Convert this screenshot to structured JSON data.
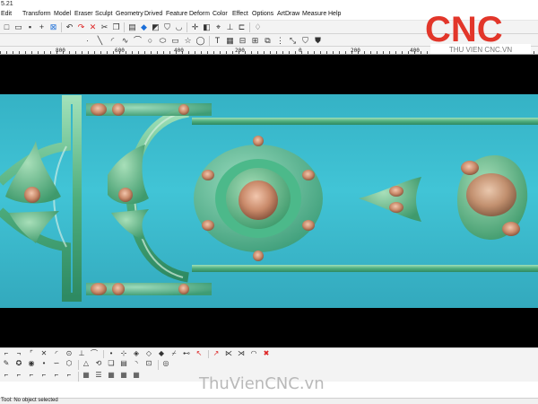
{
  "window": {
    "title": "5.21"
  },
  "menu": [
    "Edit",
    "Transform",
    "Model",
    "Eraser",
    "Sculpt",
    "Geometry",
    "Drived",
    "Feature",
    "Deform",
    "Color",
    "Effect",
    "Options",
    "ArtDraw",
    "Measure",
    "Help"
  ],
  "toolbar_top": [
    {
      "icon": "new-file-icon",
      "glyph": "□"
    },
    {
      "icon": "open-folder-icon",
      "glyph": "▭"
    },
    {
      "icon": "save-icon",
      "glyph": "▪"
    },
    {
      "icon": "crosshair-icon",
      "glyph": "+"
    },
    {
      "icon": "grid-select-icon",
      "glyph": "⊠"
    },
    {
      "icon": "undo-icon",
      "glyph": "↶"
    },
    {
      "icon": "redo-icon",
      "glyph": "↷"
    },
    {
      "icon": "delete-icon",
      "glyph": "✕"
    },
    {
      "icon": "cut-icon",
      "glyph": "✂"
    },
    {
      "icon": "copy-icon",
      "glyph": "❐"
    },
    {
      "icon": "paste-icon",
      "glyph": "▤"
    },
    {
      "icon": "color-fill-icon",
      "glyph": "◆"
    },
    {
      "icon": "cube-icon",
      "glyph": "◩"
    },
    {
      "icon": "shield-icon",
      "glyph": "⛉"
    },
    {
      "icon": "cup-icon",
      "glyph": "◡"
    },
    {
      "icon": "move-icon",
      "glyph": "✛"
    },
    {
      "icon": "mirror-icon",
      "glyph": "◧"
    },
    {
      "icon": "node-icon",
      "glyph": "⌖"
    },
    {
      "icon": "measure-icon",
      "glyph": "⊥"
    },
    {
      "icon": "align-icon",
      "glyph": "⊏"
    },
    {
      "icon": "lamp-icon",
      "glyph": "♢"
    }
  ],
  "toolbar_draw": [
    {
      "icon": "point-icon",
      "glyph": "·"
    },
    {
      "icon": "line-icon",
      "glyph": "╲"
    },
    {
      "icon": "arc-icon",
      "glyph": "◜"
    },
    {
      "icon": "curve-icon",
      "glyph": "∿"
    },
    {
      "icon": "polyline-icon",
      "glyph": "⌒"
    },
    {
      "icon": "circle-icon",
      "glyph": "○"
    },
    {
      "icon": "ellipse-icon",
      "glyph": "⬭"
    },
    {
      "icon": "rectangle-icon",
      "glyph": "▭"
    },
    {
      "icon": "star-icon",
      "glyph": "☆"
    },
    {
      "icon": "ring-icon",
      "glyph": "◯"
    },
    {
      "icon": "text-tool-icon",
      "glyph": "T"
    },
    {
      "icon": "grid-icon",
      "glyph": "▦"
    },
    {
      "icon": "align-left-icon",
      "glyph": "⊟"
    },
    {
      "icon": "distribute-icon",
      "glyph": "⊞"
    },
    {
      "icon": "group-icon",
      "glyph": "⧉"
    },
    {
      "icon": "array-icon",
      "glyph": "⋮"
    },
    {
      "icon": "scale-icon",
      "glyph": "⤡"
    },
    {
      "icon": "badge-icon",
      "glyph": "⛉"
    },
    {
      "icon": "shield-alt-icon",
      "glyph": "⛊"
    }
  ],
  "ruler": {
    "labels": [
      "800",
      "600",
      "400",
      "200",
      "0",
      "200",
      "400",
      "600"
    ]
  },
  "props_row1": [
    {
      "icon": "snap-start-icon",
      "glyph": "⌐"
    },
    {
      "icon": "snap-end-icon",
      "glyph": "¬"
    },
    {
      "icon": "snap-mid-icon",
      "glyph": "⌜"
    },
    {
      "icon": "snap-cross-icon",
      "glyph": "✕"
    },
    {
      "icon": "snap-arc-icon",
      "glyph": "◜"
    },
    {
      "icon": "snap-center-icon",
      "glyph": "⊙"
    },
    {
      "icon": "snap-perp-icon",
      "glyph": "⊥"
    },
    {
      "icon": "snap-tangent-icon",
      "glyph": "⌒"
    },
    {
      "icon": "snap-point-icon",
      "glyph": "•"
    },
    {
      "icon": "snap-near-icon",
      "glyph": "⊹"
    },
    {
      "icon": "node-edit-icon",
      "glyph": "◈"
    },
    {
      "icon": "node-add-icon",
      "glyph": "◇"
    },
    {
      "icon": "node-del-icon",
      "glyph": "◆"
    },
    {
      "icon": "break-icon",
      "glyph": "⌿"
    },
    {
      "icon": "join-icon",
      "glyph": "⊷"
    },
    {
      "icon": "red-arrow-icon",
      "glyph": "↖"
    },
    {
      "icon": "red-arrow-alt-icon",
      "glyph": "↗"
    },
    {
      "icon": "trim-icon",
      "glyph": "⋉"
    },
    {
      "icon": "extend-icon",
      "glyph": "⋊"
    },
    {
      "icon": "fillet-icon",
      "glyph": "◠"
    },
    {
      "icon": "red-close-icon",
      "glyph": "✖"
    }
  ],
  "props_row2": [
    {
      "icon": "pen-icon",
      "glyph": "✎"
    },
    {
      "icon": "lightbulb-icon",
      "glyph": "✪"
    },
    {
      "icon": "node-yellow-icon",
      "glyph": "◉"
    },
    {
      "icon": "dot-tool-icon",
      "glyph": "•"
    },
    {
      "icon": "wave-icon",
      "glyph": "∽"
    },
    {
      "icon": "polygon-icon",
      "glyph": "⬡"
    },
    {
      "icon": "triangle-icon",
      "glyph": "△"
    },
    {
      "icon": "rotate-icon",
      "glyph": "⟲"
    },
    {
      "icon": "pages-icon",
      "glyph": "❏"
    },
    {
      "icon": "document-icon",
      "glyph": "▤"
    },
    {
      "icon": "arc-tool-icon",
      "glyph": "◝"
    },
    {
      "icon": "offset-icon",
      "glyph": "⊡"
    },
    {
      "icon": "spiral-icon",
      "glyph": "◎"
    }
  ],
  "props_row3": [
    {
      "icon": "corner-a-icon",
      "glyph": "⌐"
    },
    {
      "icon": "corner-b-icon",
      "glyph": "⌐"
    },
    {
      "icon": "corner-c-icon",
      "glyph": "⌐"
    },
    {
      "icon": "corner-d-icon",
      "glyph": "⌐"
    },
    {
      "icon": "corner-e-icon",
      "glyph": "⌐"
    },
    {
      "icon": "corner-f-icon",
      "glyph": "⌐"
    },
    {
      "icon": "table-icon",
      "glyph": "▦"
    },
    {
      "icon": "list-icon",
      "glyph": "☰"
    },
    {
      "icon": "grid-small-icon",
      "glyph": "▦"
    },
    {
      "icon": "grid-medium-icon",
      "glyph": "▦"
    },
    {
      "icon": "grid-large-icon",
      "glyph": "▦"
    }
  ],
  "logo": {
    "brand": "CNC",
    "subtitle": "THU VIEN CNC.VN",
    "color": "#e2362a"
  },
  "watermark": "ThuVienCNC.vn",
  "status": {
    "text": "Tool: No object selected"
  },
  "colors": {
    "relief_background": "#3cbcd0",
    "relief_green": "#4da878",
    "relief_copper": "#c98a6a",
    "canvas": "#000000"
  }
}
